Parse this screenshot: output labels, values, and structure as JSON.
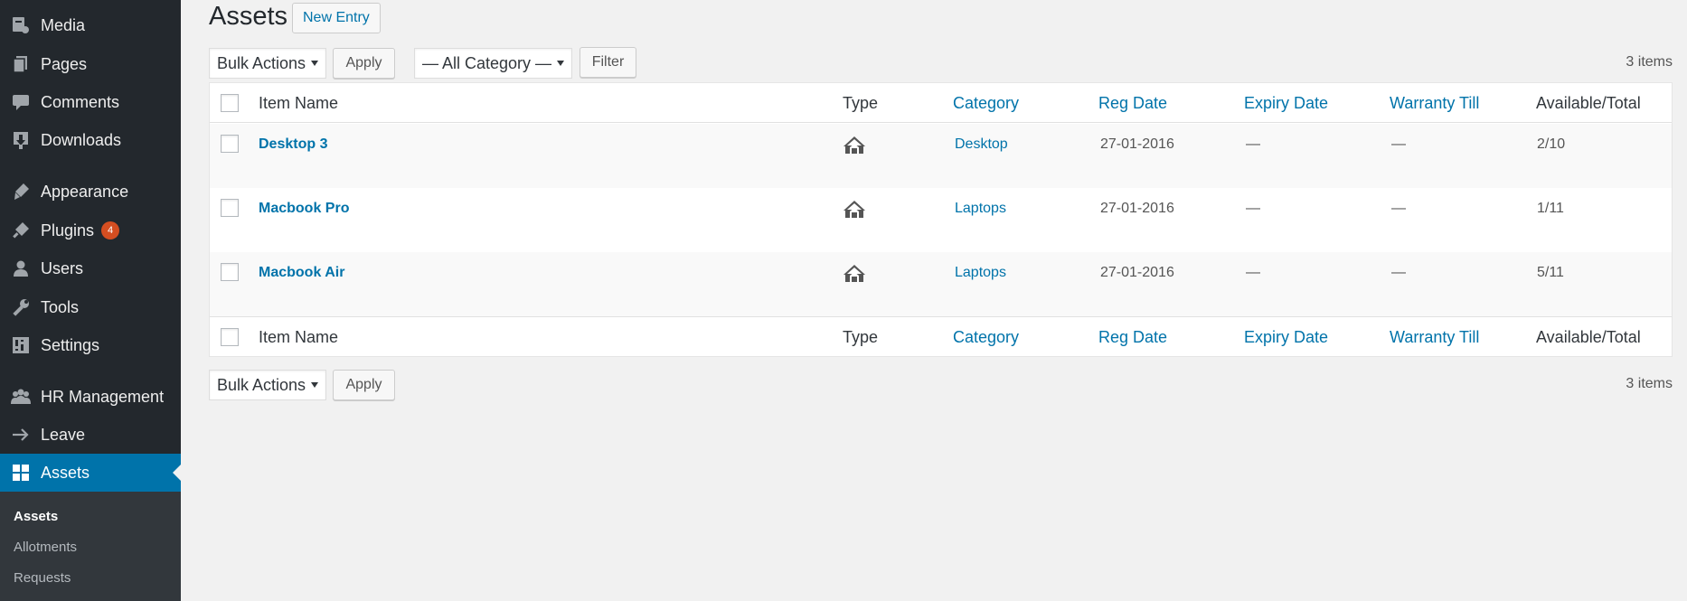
{
  "sidebar": {
    "items": [
      {
        "label": "Media",
        "icon": "media-icon"
      },
      {
        "label": "Pages",
        "icon": "pages-icon"
      },
      {
        "label": "Comments",
        "icon": "comments-icon"
      },
      {
        "label": "Downloads",
        "icon": "downloads-icon"
      },
      {
        "label": "Appearance",
        "icon": "appearance-icon"
      },
      {
        "label": "Plugins",
        "icon": "plugins-icon",
        "badge": "4"
      },
      {
        "label": "Users",
        "icon": "users-icon"
      },
      {
        "label": "Tools",
        "icon": "tools-icon"
      },
      {
        "label": "Settings",
        "icon": "settings-icon"
      },
      {
        "label": "HR Management",
        "icon": "hr-management-icon"
      },
      {
        "label": "Leave",
        "icon": "leave-arrow-icon"
      },
      {
        "label": "Assets",
        "icon": "assets-grid-icon",
        "current": true
      }
    ],
    "submenu": [
      {
        "label": "Assets",
        "current": true
      },
      {
        "label": "Allotments"
      },
      {
        "label": "Requests"
      }
    ]
  },
  "header": {
    "title": "Assets",
    "new_entry_label": "New Entry"
  },
  "toolbar_top": {
    "bulk_actions": "Bulk Actions",
    "apply": "Apply",
    "category_filter": "— All Category —",
    "filter": "Filter",
    "items_count": "3 items"
  },
  "table": {
    "columns": [
      "Item Name",
      "Type",
      "Category",
      "Reg Date",
      "Expiry Date",
      "Warranty Till",
      "Available/Total"
    ],
    "rows": [
      {
        "name": "Desktop 3",
        "type_icon": "asset-type-icon",
        "category": "Desktop",
        "reg_date": "27-01-2016",
        "expiry_date": "—",
        "warranty_till": "—",
        "available_total": "2/10"
      },
      {
        "name": "Macbook Pro",
        "type_icon": "asset-type-icon",
        "category": "Laptops",
        "reg_date": "27-01-2016",
        "expiry_date": "—",
        "warranty_till": "—",
        "available_total": "1/11"
      },
      {
        "name": "Macbook Air",
        "type_icon": "asset-type-icon",
        "category": "Laptops",
        "reg_date": "27-01-2016",
        "expiry_date": "—",
        "warranty_till": "—",
        "available_total": "5/11"
      }
    ]
  },
  "toolbar_bottom": {
    "bulk_actions": "Bulk Actions",
    "apply": "Apply",
    "items_count": "3 items"
  },
  "colors": {
    "sidebar_bg": "#23282d",
    "submenu_bg": "#32373c",
    "accent": "#0073aa",
    "badge": "#d54e21",
    "page_bg": "#f1f1f1"
  }
}
